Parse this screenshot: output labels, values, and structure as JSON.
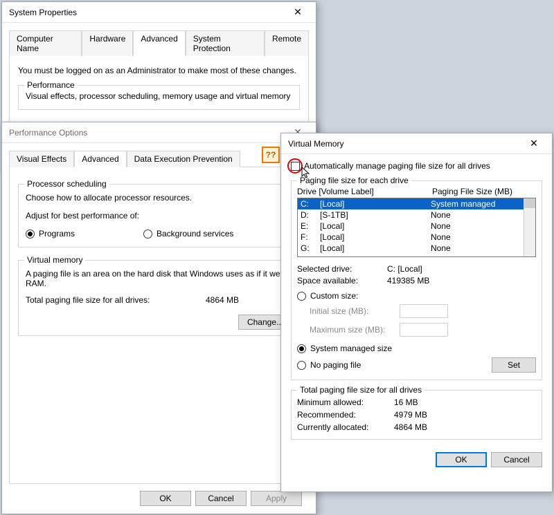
{
  "sysprops": {
    "title": "System Properties",
    "tabs": [
      "Computer Name",
      "Hardware",
      "Advanced",
      "System Protection",
      "Remote"
    ],
    "active_tab": "Advanced",
    "admin_note": "You must be logged on as an Administrator to make most of these changes.",
    "perf_group": "Performance",
    "perf_desc": "Visual effects, processor scheduling, memory usage and virtual memory"
  },
  "perfopts": {
    "title": "Performance Options",
    "tabs": [
      "Visual Effects",
      "Advanced",
      "Data Execution Prevention"
    ],
    "active_tab": "Advanced",
    "help_marker": "??",
    "sched_group": "Processor scheduling",
    "sched_desc": "Choose how to allocate processor resources.",
    "sched_adjust": "Adjust for best performance of:",
    "radio_programs": "Programs",
    "radio_bg": "Background services",
    "vm_group": "Virtual memory",
    "vm_desc": "A paging file is an area on the hard disk that Windows uses as if it were RAM.",
    "vm_total_label": "Total paging file size for all drives:",
    "vm_total_value": "4864 MB",
    "change_btn": "Change...",
    "ok": "OK",
    "cancel": "Cancel",
    "apply": "Apply"
  },
  "vmem": {
    "title": "Virtual Memory",
    "auto_label": "Automatically manage paging file size for all drives",
    "list_caption": "Paging file size for each drive",
    "hdr_drive": "Drive  [Volume Label]",
    "hdr_size": "Paging File Size (MB)",
    "drives": [
      {
        "letter": "C:",
        "label": "[Local]",
        "size": "System managed",
        "selected": true
      },
      {
        "letter": "D:",
        "label": "[S-1TB]",
        "size": "None"
      },
      {
        "letter": "E:",
        "label": "[Local]",
        "size": "None"
      },
      {
        "letter": "F:",
        "label": "[Local]",
        "size": "None"
      },
      {
        "letter": "G:",
        "label": "[Local]",
        "size": "None"
      }
    ],
    "sel_drive_label": "Selected drive:",
    "sel_drive_value": "C:  [Local]",
    "space_label": "Space available:",
    "space_value": "419385 MB",
    "radio_custom": "Custom size:",
    "initial_label": "Initial size (MB):",
    "max_label": "Maximum size (MB):",
    "radio_managed": "System managed size",
    "radio_none": "No paging file",
    "set_btn": "Set",
    "totals_caption": "Total paging file size for all drives",
    "min_label": "Minimum allowed:",
    "min_value": "16 MB",
    "rec_label": "Recommended:",
    "rec_value": "4979 MB",
    "cur_label": "Currently allocated:",
    "cur_value": "4864 MB",
    "ok": "OK",
    "cancel": "Cancel"
  }
}
